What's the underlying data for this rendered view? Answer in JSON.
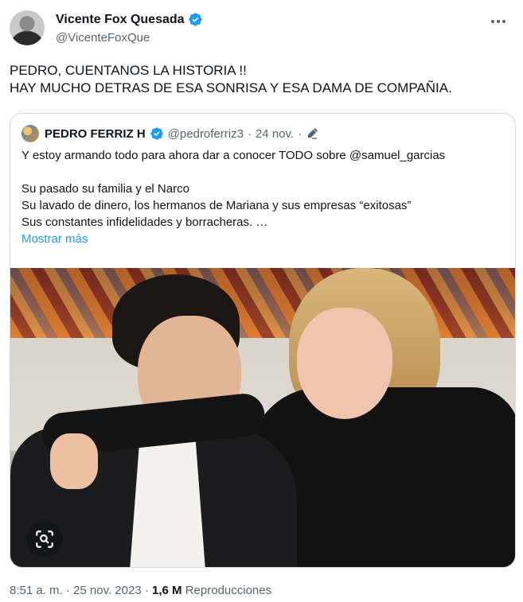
{
  "author": {
    "display_name": "Vicente Fox Quesada",
    "handle": "@VicenteFoxQue",
    "verified_icon": "verified-badge-icon"
  },
  "tweet": {
    "lines": [
      "PEDRO, CUENTANOS LA HISTORIA !!",
      "HAY MUCHO DETRAS DE ESA SONRISA Y ESA DAMA DE COMPAÑIA."
    ]
  },
  "quote": {
    "display_name": "PEDRO FERRIZ H",
    "handle": "@pedroferriz3",
    "separator": "·",
    "date": "24 nov.",
    "edited_icon": "pencil-icon",
    "lines": [
      "Y estoy armando todo para ahora dar a conocer TODO sobre @samuel_garcias",
      "Su pasado su familia y  el Narco",
      "Su lavado de dinero, los hermanos de Mariana y sus empresas “exitosas”",
      "Sus constantes infidelidades y borracheras. …"
    ],
    "show_more": "Mostrar más"
  },
  "footer": {
    "time": "8:51 a. m.",
    "sep1": "·",
    "date": "25 nov. 2023",
    "sep2": "·",
    "views_count": "1,6 M",
    "views_label": "Reproducciones"
  },
  "colors": {
    "accent": "#1d9bf0",
    "secondary_text": "#536471",
    "border": "#cfd9de"
  }
}
